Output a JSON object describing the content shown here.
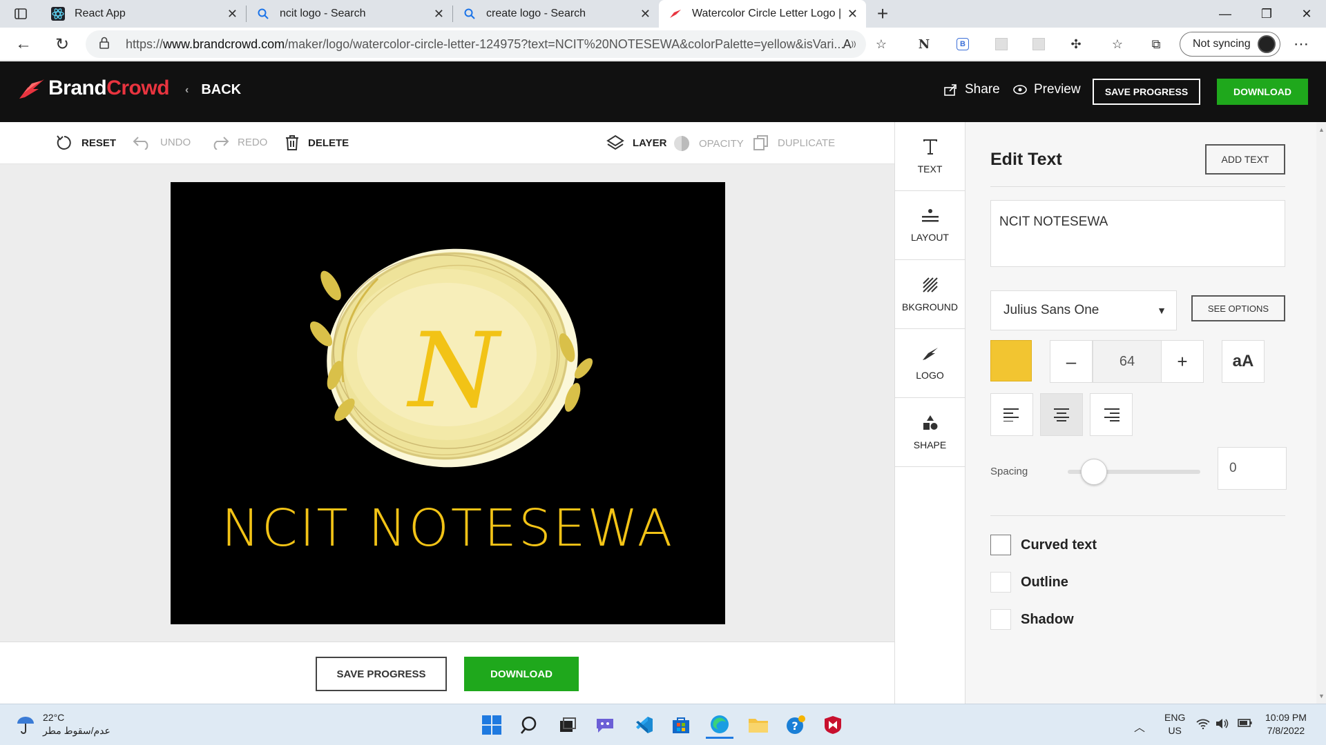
{
  "browser": {
    "tabs": [
      {
        "title": "React App",
        "icon": "react-icon",
        "active": false
      },
      {
        "title": "ncit logo - Search",
        "icon": "search-icon",
        "active": false
      },
      {
        "title": "create logo - Search",
        "icon": "search-icon",
        "active": false
      },
      {
        "title": "Watercolor Circle Letter Logo | B",
        "icon": "brandcrowd-icon",
        "active": true
      }
    ],
    "url_prefix": "https://",
    "url_host": "www.brandcrowd.com",
    "url_rest": "/maker/logo/watercolor-circle-letter-124975?text=NCIT%20NOTESEWA&colorPalette=yellow&isVari...",
    "sync_label": "Not syncing",
    "ext_label_n": "N",
    "ext_label_b": "B"
  },
  "header": {
    "brand_part1": "Brand",
    "brand_part2": "Crowd",
    "back_label": "BACK",
    "share_label": "Share",
    "preview_label": "Preview",
    "save_progress_label": "SAVE PROGRESS",
    "download_label": "DOWNLOAD"
  },
  "toolbar": {
    "reset": "RESET",
    "undo": "UNDO",
    "redo": "REDO",
    "delete": "DELETE",
    "layer": "LAYER",
    "opacity": "OPACITY",
    "duplicate": "DUPLICATE"
  },
  "canvas": {
    "logo_text": "NCIT NOTESEWA",
    "monogram": "N",
    "background_color": "#000000",
    "text_color": "#f2c316",
    "circle_color": "#efe6a0"
  },
  "bottom": {
    "save_progress_label": "SAVE PROGRESS",
    "download_label": "DOWNLOAD"
  },
  "sidenav": [
    {
      "label": "TEXT",
      "icon": "text-icon"
    },
    {
      "label": "LAYOUT",
      "icon": "layout-icon"
    },
    {
      "label": "BKGROUND",
      "icon": "background-icon"
    },
    {
      "label": "LOGO",
      "icon": "logo-icon"
    },
    {
      "label": "SHAPE",
      "icon": "shape-icon"
    }
  ],
  "panel": {
    "title": "Edit Text",
    "add_text_label": "ADD TEXT",
    "text_value": "NCIT NOTESEWA",
    "font_name": "Julius Sans One",
    "see_options_label": "SEE OPTIONS",
    "color_swatch": "#f2c531",
    "font_size": "64",
    "minus": "–",
    "plus": "+",
    "case_label": "aA",
    "alignment_selected": "center",
    "spacing_label": "Spacing",
    "spacing_value": "0",
    "spacing_slider_fraction": 0.2,
    "options": [
      {
        "label": "Curved text",
        "checked": false
      },
      {
        "label": "Outline",
        "checked": false
      },
      {
        "label": "Shadow",
        "checked": false
      }
    ]
  },
  "taskbar": {
    "temperature": "22°C",
    "weather_desc": "عدم/سقوط مطر",
    "lang_line1": "ENG",
    "lang_line2": "US",
    "time": "10:09 PM",
    "date": "7/8/2022"
  }
}
